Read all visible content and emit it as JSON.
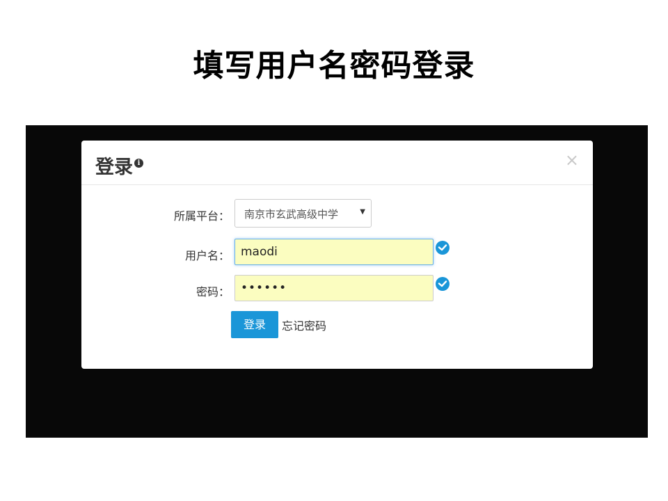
{
  "slide": {
    "title": "填写用户名密码登录"
  },
  "modal": {
    "title": "登录",
    "info_icon": "info-circle-icon",
    "close_symbol": "×",
    "platform": {
      "label": "所属平台：",
      "selected": "南京市玄武高级中学"
    },
    "username": {
      "label": "用户名：",
      "value": "maodi"
    },
    "password": {
      "label": "密码：",
      "masked_value": "••••••"
    },
    "login_button": "登录",
    "forgot_link": "忘记密码",
    "colors": {
      "accent": "#1a96d8",
      "input_fill": "#fbfdc0",
      "backdrop": "#080808"
    }
  }
}
